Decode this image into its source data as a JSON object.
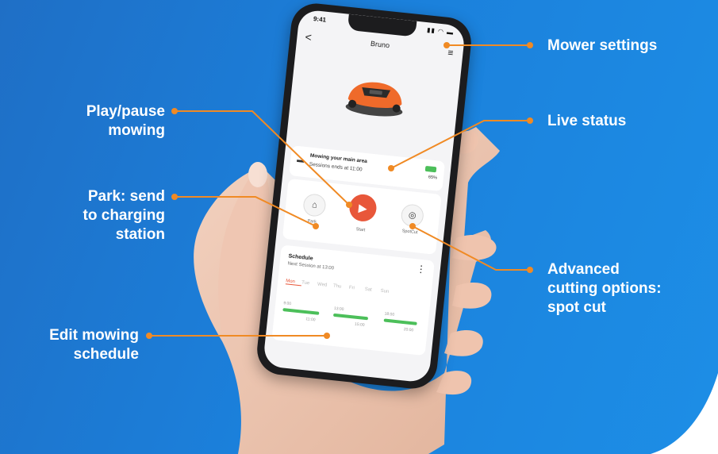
{
  "annotations": {
    "mower_settings": "Mower settings",
    "live_status": "Live status",
    "play_pause_l1": "Play/pause",
    "play_pause_l2": "mowing",
    "park_l1": "Park: send",
    "park_l2": "to charging",
    "park_l3": "station",
    "advanced_l1": "Advanced",
    "advanced_l2": "cutting options:",
    "advanced_l3": "spot cut",
    "edit_l1": "Edit mowing",
    "edit_l2": "schedule"
  },
  "phone": {
    "status_time": "9:41",
    "status_icons": "▮▮ ◠ ▬",
    "nav": {
      "back": "<",
      "title": "Bruno",
      "menu": "≡"
    },
    "status_card": {
      "line1": "Mowing your main area",
      "line2": "Sessions ends at 11:00",
      "battery_pct": "65%"
    },
    "controls": {
      "park_label": "Park",
      "start_label": "Start",
      "spotcut_label": "SpotCut"
    },
    "schedule": {
      "title": "Schedule",
      "subtitle": "Next Session at 13:00",
      "days": [
        "Mon",
        "Tue",
        "Wed",
        "Thu",
        "Fri",
        "Sat",
        "Sun"
      ],
      "sessions": [
        {
          "start": "9:00",
          "end": "11:00"
        },
        {
          "start": "13:00",
          "end": "15:00"
        },
        {
          "start": "18:00",
          "end": "20:00"
        }
      ]
    }
  },
  "colors": {
    "accent": "#e8573a",
    "annotation": "#f08a24",
    "battery": "#4cbf5a",
    "background": "#1b80db"
  }
}
